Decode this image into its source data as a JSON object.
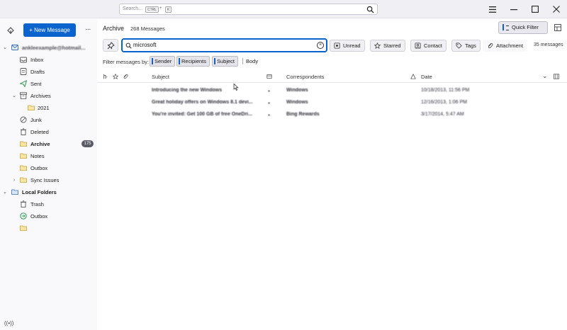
{
  "titlebar": {
    "search_placeholder": "Search...",
    "shortcut_ctrl": "CTRL",
    "shortcut_plus": "+",
    "shortcut_key": "K",
    "menu_icon": "hamburger-icon",
    "minimize_icon": "minimize-icon",
    "maximize_icon": "maximize-icon",
    "close_icon": "close-icon"
  },
  "folderpane": {
    "new_message_label": "+ New Message",
    "more_label": "···",
    "account_name": "ankleexample@hotmail...",
    "folders": [
      {
        "label": "Inbox",
        "icon": "inbox-icon"
      },
      {
        "label": "Drafts",
        "icon": "drafts-icon"
      },
      {
        "label": "Sent",
        "icon": "sent-icon"
      },
      {
        "label": "Archives",
        "icon": "archives-icon"
      },
      {
        "label": "2021",
        "icon": "folder-icon"
      },
      {
        "label": "Junk",
        "icon": "junk-icon"
      },
      {
        "label": "Deleted",
        "icon": "trash-icon"
      },
      {
        "label": "Archive",
        "icon": "folder-icon",
        "count": "175"
      },
      {
        "label": "Notes",
        "icon": "folder-icon"
      },
      {
        "label": "Outbox",
        "icon": "folder-icon"
      },
      {
        "label": "Sync Issues",
        "icon": "folder-icon"
      }
    ],
    "local_folders_label": "Local Folders",
    "local_folders": [
      {
        "label": "Trash",
        "icon": "trash-icon"
      },
      {
        "label": "Outbox",
        "icon": "outbox-icon"
      },
      {
        "label": "",
        "icon": "folder-icon"
      }
    ]
  },
  "main": {
    "folder_title": "Archive",
    "message_count": "268 Messages",
    "quick_filter_label": "Quick Filter",
    "filter_value": "microsoft",
    "toggles": {
      "unread": "Unread",
      "starred": "Starred",
      "contact": "Contact",
      "tags": "Tags",
      "attachment": "Attachment"
    },
    "match_count": "35 messages",
    "filter_by_label": "Filter messages by:",
    "chips": {
      "sender": "Sender",
      "recipients": "Recipients",
      "subject": "Subject",
      "body": "Body"
    },
    "columns": {
      "subject": "Subject",
      "correspondents": "Correspondents",
      "date": "Date"
    },
    "messages": [
      {
        "subject": "Introducing the new Windows",
        "correspondent": "Windows",
        "date": "10/18/2013, 11:56 PM"
      },
      {
        "subject": "Great holiday offers on Windows 8.1 devi...",
        "correspondent": "Windows",
        "date": "12/16/2013, 1:06 PM"
      },
      {
        "subject": "You're invited: Get 100 GB of free OneDri...",
        "correspondent": "Bing Rewards",
        "date": "3/17/2014, 5:47 AM"
      }
    ]
  },
  "colors": {
    "accent": "#0b63ce",
    "badge": "#5b5b66"
  }
}
